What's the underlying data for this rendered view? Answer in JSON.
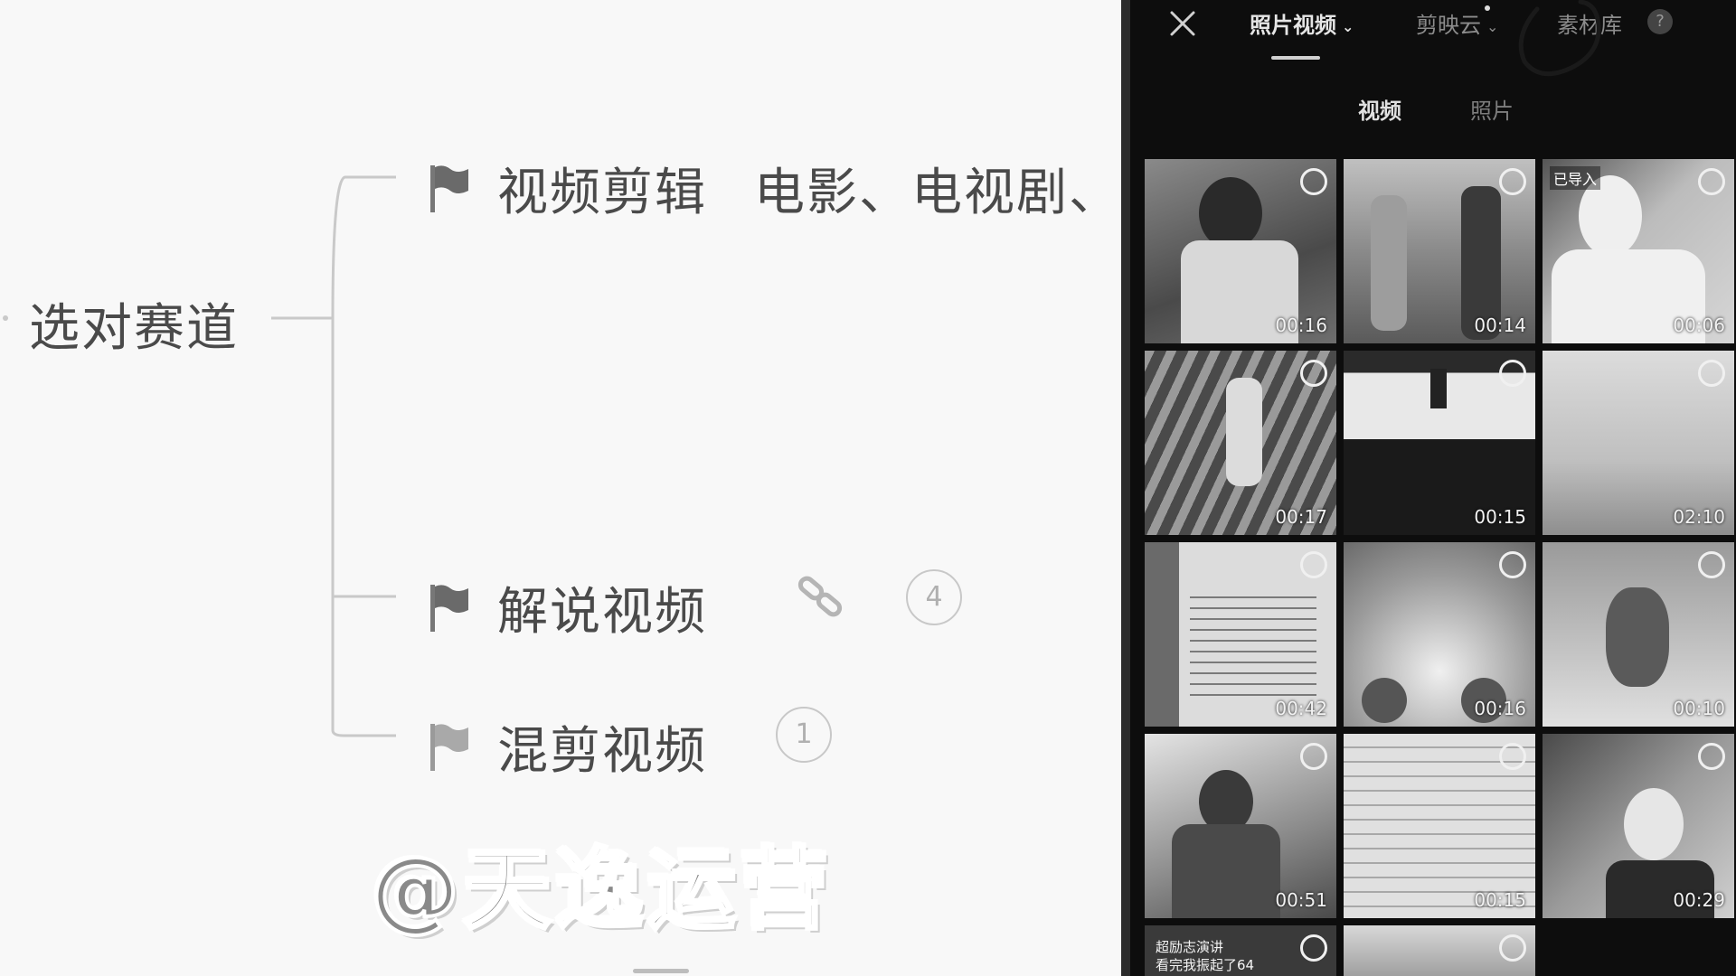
{
  "mindmap": {
    "root": "选对赛道",
    "branches": [
      {
        "label": "视频剪辑",
        "extra": "电影、电视剧、"
      },
      {
        "label": "解说视频",
        "badge": "4"
      },
      {
        "label": "混剪视频",
        "badge": "1"
      }
    ]
  },
  "watermark": "@天逸运营",
  "phone": {
    "top_tabs": [
      {
        "label": "照片视频",
        "active": true
      },
      {
        "label": "剪映云",
        "active": false
      },
      {
        "label": "素材库",
        "active": false
      }
    ],
    "help": "?",
    "sub_tabs": [
      {
        "label": "视频",
        "active": true
      },
      {
        "label": "照片",
        "active": false
      }
    ],
    "tiles": [
      {
        "duration": "00:16"
      },
      {
        "duration": "00:14"
      },
      {
        "duration": "00:06",
        "overlay": "已导入"
      },
      {
        "duration": "00:17"
      },
      {
        "duration": "00:15"
      },
      {
        "duration": "02:10"
      },
      {
        "duration": "00:42"
      },
      {
        "duration": "00:16"
      },
      {
        "duration": "00:10"
      },
      {
        "duration": "00:51"
      },
      {
        "duration": "00:15"
      },
      {
        "duration": "00:29"
      },
      {
        "duration": "",
        "caption": "超励志演讲\n看完我振起了64"
      },
      {
        "duration": ""
      }
    ]
  },
  "colors": {
    "text": "#4a4a4a",
    "connector": "#c9c9c9",
    "phone_bg": "#0d0d0d"
  }
}
